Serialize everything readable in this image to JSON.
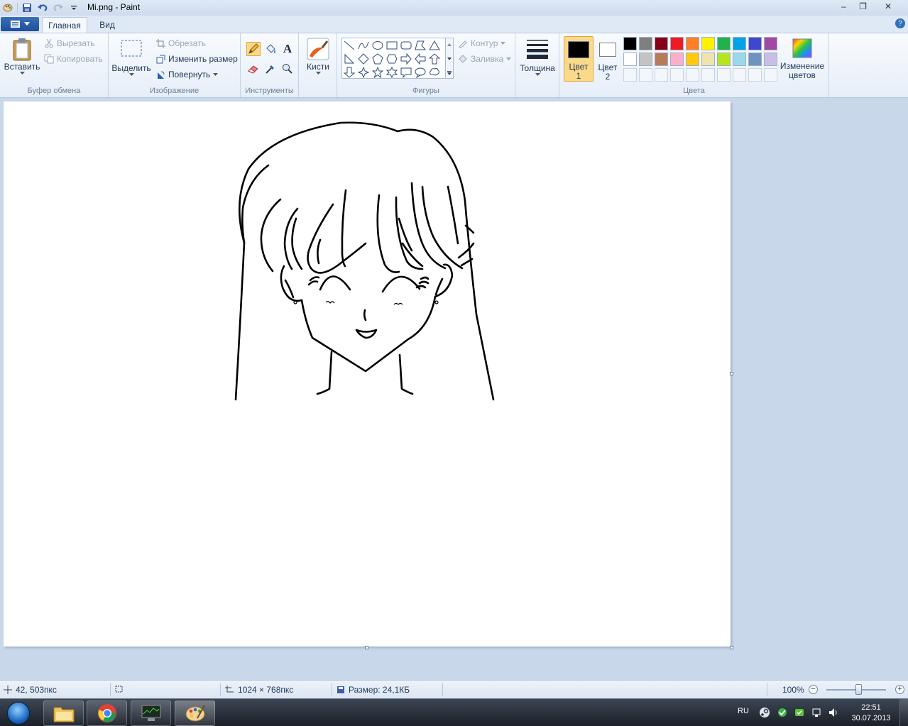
{
  "window": {
    "title": "Mi.png - Paint",
    "controls": {
      "minimize": "‒",
      "restore": "❐",
      "close": "✕"
    }
  },
  "tabs": {
    "home": "Главная",
    "view": "Вид",
    "help": "?"
  },
  "clipboard": {
    "paste": "Вставить",
    "cut": "Вырезать",
    "copy": "Копировать",
    "group": "Буфер обмена"
  },
  "image": {
    "select": "Выделить",
    "crop": "Обрезать",
    "resize": "Изменить размер",
    "rotate": "Повернуть",
    "group": "Изображение"
  },
  "tools": {
    "group": "Инструменты",
    "text_glyph": "A"
  },
  "brushes": {
    "label": "Кисти"
  },
  "shapes": {
    "outline": "Контур",
    "fill": "Заливка",
    "group": "Фигуры"
  },
  "size": {
    "label": "Толщина"
  },
  "colors": {
    "color1_line1": "Цвет",
    "color1_line2": "1",
    "color2_line1": "Цвет",
    "color2_line2": "2",
    "edit_line1": "Изменение",
    "edit_line2": "цветов",
    "group": "Цвета",
    "color1_value": "#000000",
    "color2_value": "#ffffff",
    "palette_row1": [
      "#000000",
      "#7f7f7f",
      "#880015",
      "#ed1c24",
      "#ff7f27",
      "#fff200",
      "#22b14c",
      "#00a2e8",
      "#3f48cc",
      "#a349a4"
    ],
    "palette_row2": [
      "#ffffff",
      "#c3c3c3",
      "#b97a57",
      "#ffaec9",
      "#ffc90e",
      "#efe4b0",
      "#b5e61d",
      "#99d9ea",
      "#7092be",
      "#c8bfe7"
    ]
  },
  "statusbar": {
    "cursor_pos": "42, 503пкс",
    "image_dims": "1024 × 768пкс",
    "file_size": "Размер: 24,1КБ",
    "zoom": "100%",
    "zoom_minus": "−",
    "zoom_plus": "+",
    "zoom_level": 0.5
  },
  "taskbar": {
    "lang": "RU",
    "time": "22:51",
    "date": "30.07.2013"
  }
}
